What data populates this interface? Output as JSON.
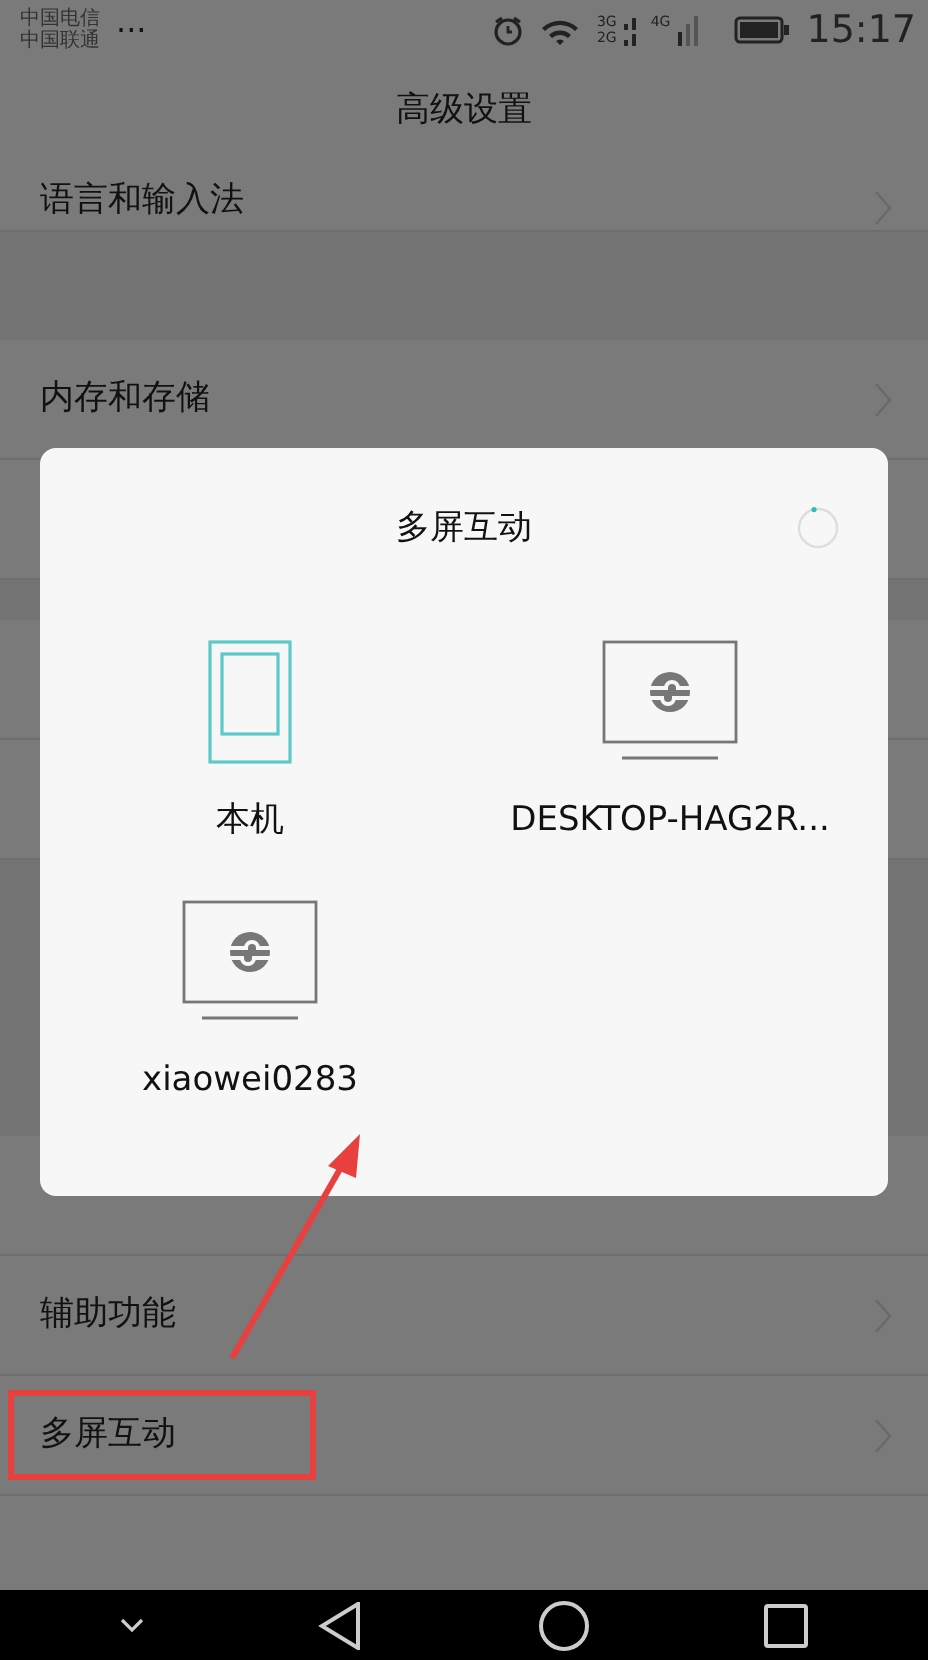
{
  "status_bar": {
    "carriers": [
      "中国电信",
      "中国联通"
    ],
    "more": "...",
    "networks": [
      "3G",
      "2G",
      "4G"
    ],
    "time": "15:17"
  },
  "header": {
    "title": "高级设置"
  },
  "settings": [
    {
      "kind": "row",
      "label": "语言和输入法"
    },
    {
      "kind": "gap"
    },
    {
      "kind": "row",
      "label": "内存和存储"
    },
    {
      "kind": "hidden"
    },
    {
      "kind": "gap"
    },
    {
      "kind": "hidden"
    },
    {
      "kind": "hidden"
    },
    {
      "kind": "gap"
    },
    {
      "kind": "hidden"
    },
    {
      "kind": "row",
      "label": "辅助功能"
    },
    {
      "kind": "row",
      "label": "多屏互动",
      "highlighted": true
    }
  ],
  "dialog": {
    "title": "多屏互动",
    "loading": true,
    "devices": [
      {
        "kind": "phone",
        "name": "本机"
      },
      {
        "kind": "computer",
        "name": "DESKTOP-HAG2R..."
      },
      {
        "kind": "computer",
        "name": "xiaowei0283"
      }
    ]
  },
  "annotations": [
    {
      "kind": "arrow",
      "color": "#e8403f"
    }
  ]
}
